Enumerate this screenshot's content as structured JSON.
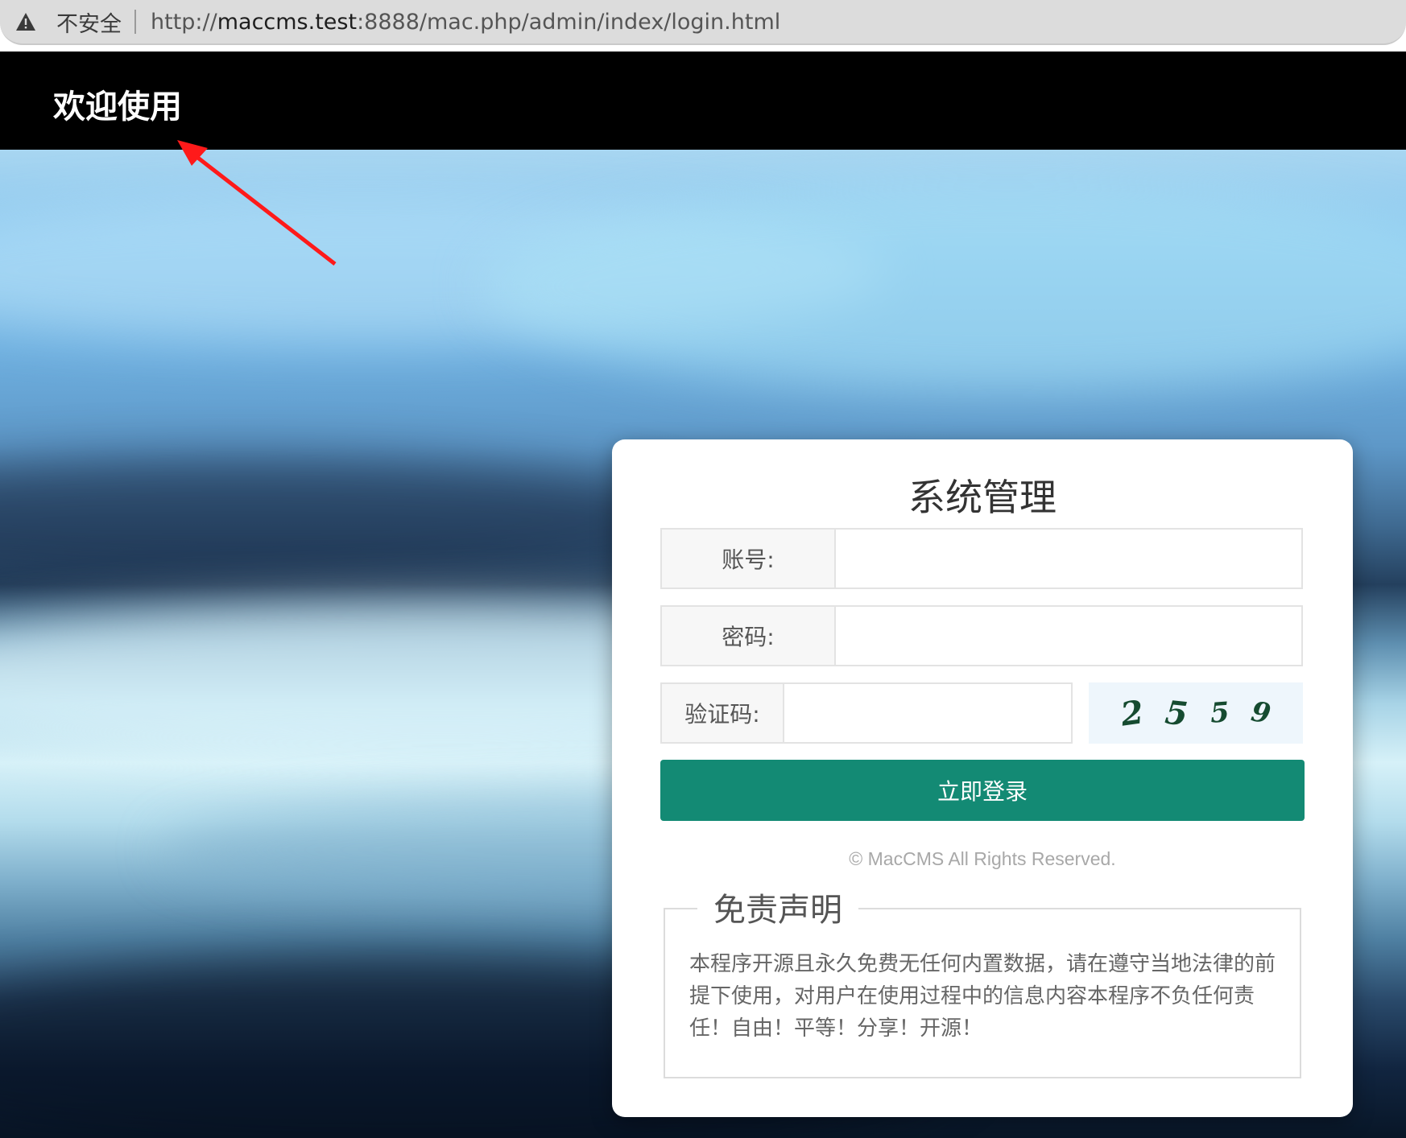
{
  "browser": {
    "security_label": "不安全",
    "url_prefix": "http://",
    "url_host": "maccms.test",
    "url_rest": ":8888/mac.php/admin/index/login.html",
    "warning_icon": "warning-triangle-icon"
  },
  "header": {
    "title": "欢迎使用"
  },
  "login": {
    "title": "系统管理",
    "username_label": "账号:",
    "username_value": "",
    "password_label": "密码:",
    "password_value": "",
    "captcha_label": "验证码:",
    "captcha_value": "",
    "captcha_digits": [
      "2",
      "5",
      "5",
      "9"
    ],
    "submit_label": "立即登录",
    "copyright": "© MacCMS All Rights Reserved."
  },
  "disclaimer": {
    "title": "免责声明",
    "text": "本程序开源且永久免费无任何内置数据，请在遵守当地法律的前提下使用，对用户在使用过程中的信息内容本程序不负任何责任！自由！平等！分享！开源！"
  },
  "colors": {
    "header_bg": "#000000",
    "button_bg": "#138a74",
    "annotation_arrow": "#ff1a1a"
  }
}
